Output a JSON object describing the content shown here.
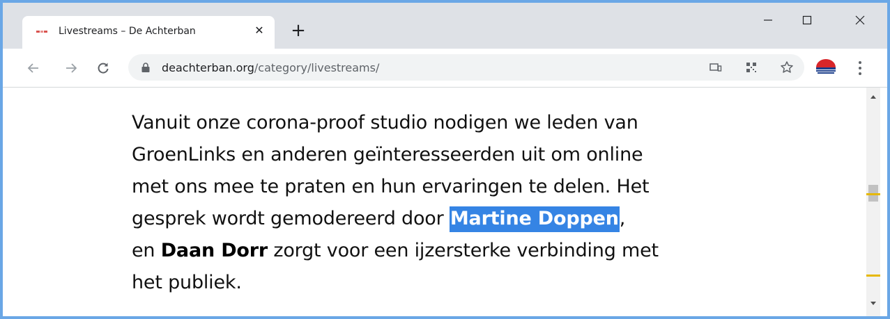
{
  "tab": {
    "title": "Livestreams – De Achterban",
    "close_label": "✕",
    "new_tab_label": "+"
  },
  "window_controls": {
    "minimize_icon": "minimize-icon",
    "maximize_icon": "maximize-icon",
    "close_icon": "close-icon"
  },
  "toolbar": {
    "url_host": "deachterban.org",
    "url_path": "/category/livestreams/",
    "icons": [
      "back-arrow-icon",
      "forward-arrow-icon",
      "reload-icon",
      "lock-icon",
      "cast-icon",
      "qr-code-icon",
      "star-icon",
      "profile-avatar",
      "more-menu-icon"
    ]
  },
  "article": {
    "line1": "Vanuit onze corona-proof studio nodigen we leden van",
    "line2": "GroenLinks en anderen geïnteresseerden uit om online",
    "line3": "met ons mee te praten en hun ervaringen te delen. Het",
    "line4_pre": "gesprek wordt gemodereerd door ",
    "line4_highlight": "Martine Doppen",
    "line4_post": ",",
    "line5_pre": "en ",
    "line5_bold": "Daan Dorr",
    "line5_post": " zorgt voor een ijzersterke verbinding met",
    "line6": "het publiek."
  },
  "colors": {
    "selection": "#3584e4",
    "tabstrip": "#dee1e6",
    "window_border": "#6aa7e6",
    "find_marker": "#e6b800"
  }
}
